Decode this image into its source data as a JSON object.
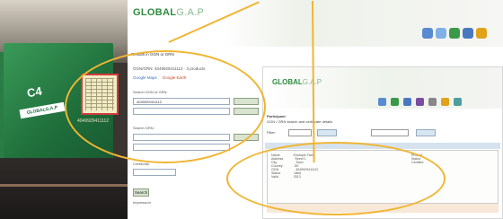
{
  "photo": {
    "logo_text": "C4",
    "logo_band_text": "GLOBALG.A.P",
    "label_code": "4049929411112"
  },
  "app": {
    "brand_main": "GLOBAL",
    "brand_gap": "G.A.P",
    "doc_title": "Results in GGN or GRN",
    "meta_line": "GGN/GRN: 4049929411112 · 3 products",
    "link_maps": "Google Maps",
    "link_earth": "Google Earth",
    "section1_label": "Search GGN of GRN:",
    "field1": "4049929411112",
    "section2_label": "Search GRN:",
    "field2": "",
    "section3_label": "Certificate:",
    "field3": "",
    "button_search": "Search",
    "footer_text": "Impressum"
  },
  "inner": {
    "brand_main": "GLOBAL",
    "brand_gap": "G.A.P",
    "title": "Participant",
    "subtitle": "GGN / GRN search and certificate details",
    "filter_text": "Filter:",
    "tabs": [
      "General",
      "Site",
      "Certificates",
      "Products",
      "Options",
      "Produce Handling",
      "History"
    ],
    "rows": [
      {
        "k": "Name",
        "v": "Example Farm"
      },
      {
        "k": "Address",
        "v": "Street 1"
      },
      {
        "k": "City",
        "v": "Town"
      },
      {
        "k": "Country",
        "v": "DE"
      },
      {
        "k": "GGN",
        "v": "4049929411112"
      },
      {
        "k": "Status",
        "v": "Valid"
      },
      {
        "k": "Valid",
        "v": "2013"
      }
    ],
    "right_rows": [
      "Product",
      "Status",
      "Certified"
    ]
  },
  "colors": {
    "brand_green": "#2e8b3d",
    "highlight": "#f0b533",
    "link_blue": "#3b72b8",
    "link_red": "#c8452a"
  }
}
